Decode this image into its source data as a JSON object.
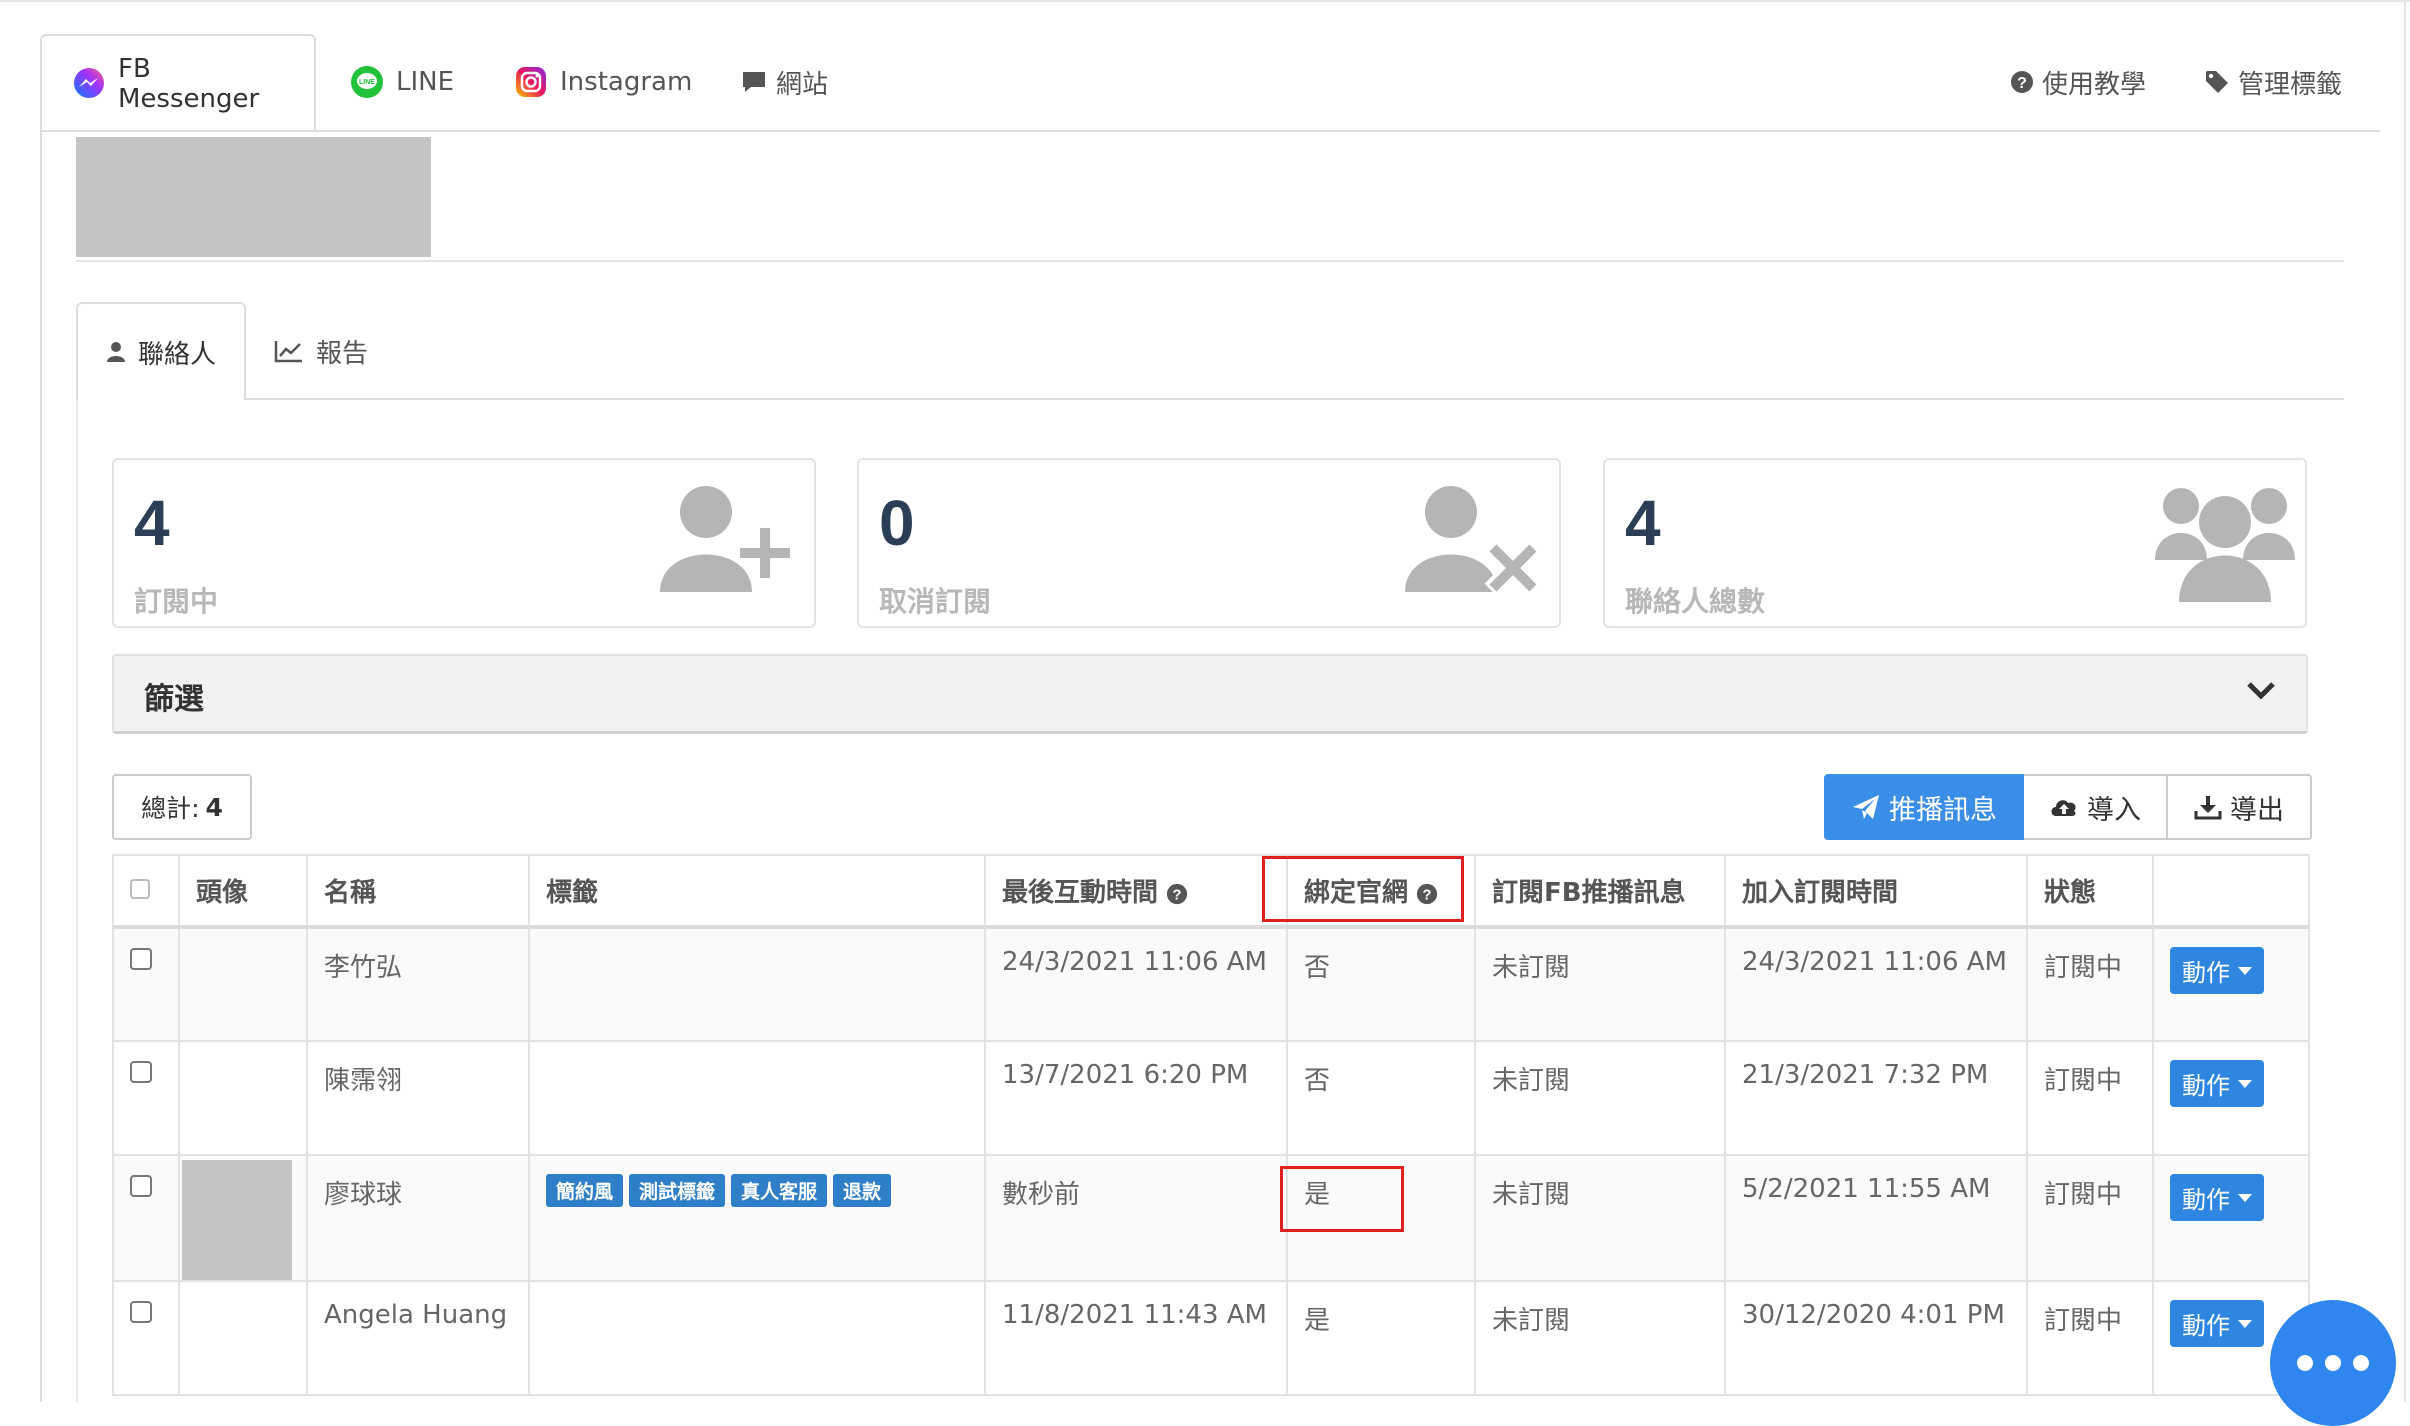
{
  "platform_tabs": [
    {
      "label": "FB Messenger",
      "icon": "messenger-icon"
    },
    {
      "label": "LINE",
      "icon": "line-icon"
    },
    {
      "label": "Instagram",
      "icon": "instagram-icon"
    },
    {
      "label": "網站",
      "icon": "chat-icon"
    }
  ],
  "header_links": {
    "tutorial": "使用教學",
    "manage_tags": "管理標籤"
  },
  "sub_tabs": {
    "contacts": "聯絡人",
    "report": "報告"
  },
  "stats": [
    {
      "value": "4",
      "label": "訂閱中",
      "icon": "user-plus-icon"
    },
    {
      "value": "0",
      "label": "取消訂閱",
      "icon": "user-remove-icon"
    },
    {
      "value": "4",
      "label": "聯絡人總數",
      "icon": "users-icon"
    }
  ],
  "filter": {
    "label": "篩選"
  },
  "total": {
    "label": "總計:",
    "value": "4"
  },
  "buttons": {
    "broadcast": "推播訊息",
    "import": "導入",
    "export": "導出"
  },
  "table": {
    "headers": [
      "頭像",
      "名稱",
      "標籤",
      "最後互動時間",
      "綁定官網",
      "訂閱FB推播訊息",
      "加入訂閱時間",
      "狀態"
    ],
    "action_label": "動作",
    "rows": [
      {
        "name": "李竹弘",
        "tags": [],
        "last_interaction": "24/3/2021 11:06 AM",
        "bound": "否",
        "fb_subscribed": "未訂閱",
        "joined": "24/3/2021 11:06 AM",
        "status": "訂閱中"
      },
      {
        "name": "陳霈翎",
        "tags": [],
        "last_interaction": "13/7/2021 6:20 PM",
        "bound": "否",
        "fb_subscribed": "未訂閱",
        "joined": "21/3/2021 7:32 PM",
        "status": "訂閱中"
      },
      {
        "name": "廖球球",
        "tags": [
          "簡約風",
          "測試標籤",
          "真人客服",
          "退款"
        ],
        "last_interaction": "數秒前",
        "bound": "是",
        "fb_subscribed": "未訂閱",
        "joined": "5/2/2021 11:55 AM",
        "status": "訂閱中"
      },
      {
        "name": "Angela Huang",
        "tags": [],
        "last_interaction": "11/8/2021 11:43 AM",
        "bound": "是",
        "fb_subscribed": "未訂閱",
        "joined": "30/12/2020 4:01 PM",
        "status": "訂閱中"
      }
    ]
  },
  "colors": {
    "primary": "#3b8ee8",
    "tag": "#2f7ec8",
    "highlight": "#e0201f",
    "stat_number": "#2c3e55"
  }
}
